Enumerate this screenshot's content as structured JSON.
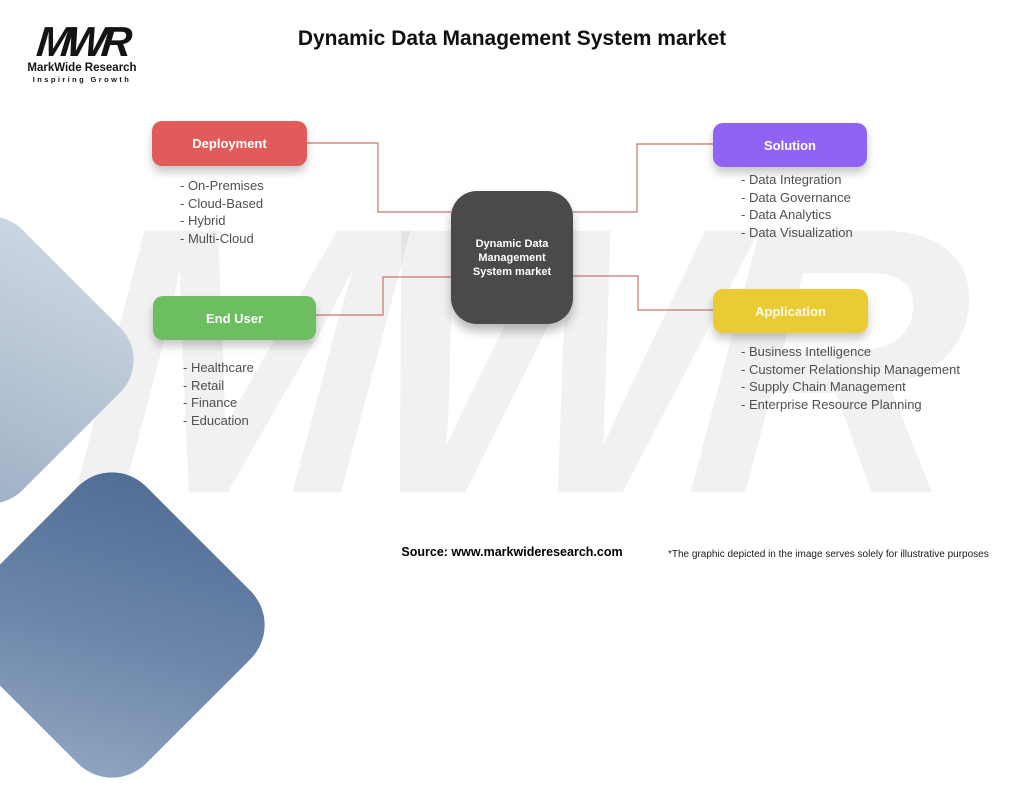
{
  "header": {
    "logo": {
      "acronym": "MWR",
      "name": "MarkWide Research",
      "tagline": "Inspiring Growth"
    },
    "title": "Dynamic Data Management System market"
  },
  "watermark": "MWR",
  "center_node": {
    "label": "Dynamic Data Management System market"
  },
  "sections": {
    "deployment": {
      "label": "Deployment",
      "color": "#e25b5b",
      "items": [
        "- On-Premises",
        "- Cloud-Based",
        "- Hybrid",
        "- Multi-Cloud"
      ]
    },
    "solution": {
      "label": "Solution",
      "color": "#9163f2",
      "items": [
        "- Data Integration",
        "- Data Governance",
        "- Data Analytics",
        "- Data Visualization"
      ]
    },
    "end_user": {
      "label": "End User",
      "color": "#6cbe61",
      "items": [
        "- Healthcare",
        "- Retail",
        "- Finance",
        "- Education"
      ]
    },
    "application": {
      "label": "Application",
      "color": "#eacb33",
      "items": [
        "- Business Intelligence",
        "- Customer Relationship Management",
        "- Supply Chain Management",
        "- Enterprise Resource Planning"
      ]
    }
  },
  "colors": {
    "center_node": "#4a4a4a",
    "connector": "#c4776f",
    "diamond_light": "#b3c1d2",
    "diamond_dark": "#5d7699"
  },
  "footer": {
    "source": "Source: www.markwideresearch.com",
    "disclaimer": "*The graphic depicted in the image serves solely for illustrative purposes"
  }
}
